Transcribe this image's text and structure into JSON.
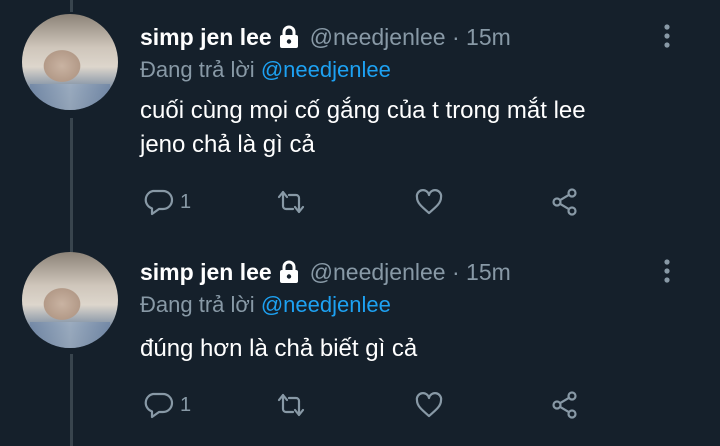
{
  "tweets": [
    {
      "name": "simp jen lee",
      "handle": "@needjenlee",
      "time": "15m",
      "reply_prefix": "Đang trả lời",
      "reply_to": "@needjenlee",
      "text_lines": [
        "cuối cùng mọi cố gắng của t trong mắt lee",
        "jeno chả là gì cả"
      ],
      "reply_count": "1"
    },
    {
      "name": "simp jen lee",
      "handle": "@needjenlee",
      "time": "15m",
      "reply_prefix": "Đang trả lời",
      "reply_to": "@needjenlee",
      "text_lines": [
        "đúng hơn là chả biết gì cả"
      ],
      "reply_count": "1"
    }
  ],
  "separator": " · ",
  "icons": [
    "lock-icon",
    "more-vertical-icon",
    "reply-icon",
    "retweet-icon",
    "like-icon",
    "share-icon"
  ],
  "colors": {
    "background": "#15202b",
    "text": "#ffffff",
    "muted": "#8899a6",
    "accent": "#1da1f2",
    "thread": "#38444d"
  }
}
